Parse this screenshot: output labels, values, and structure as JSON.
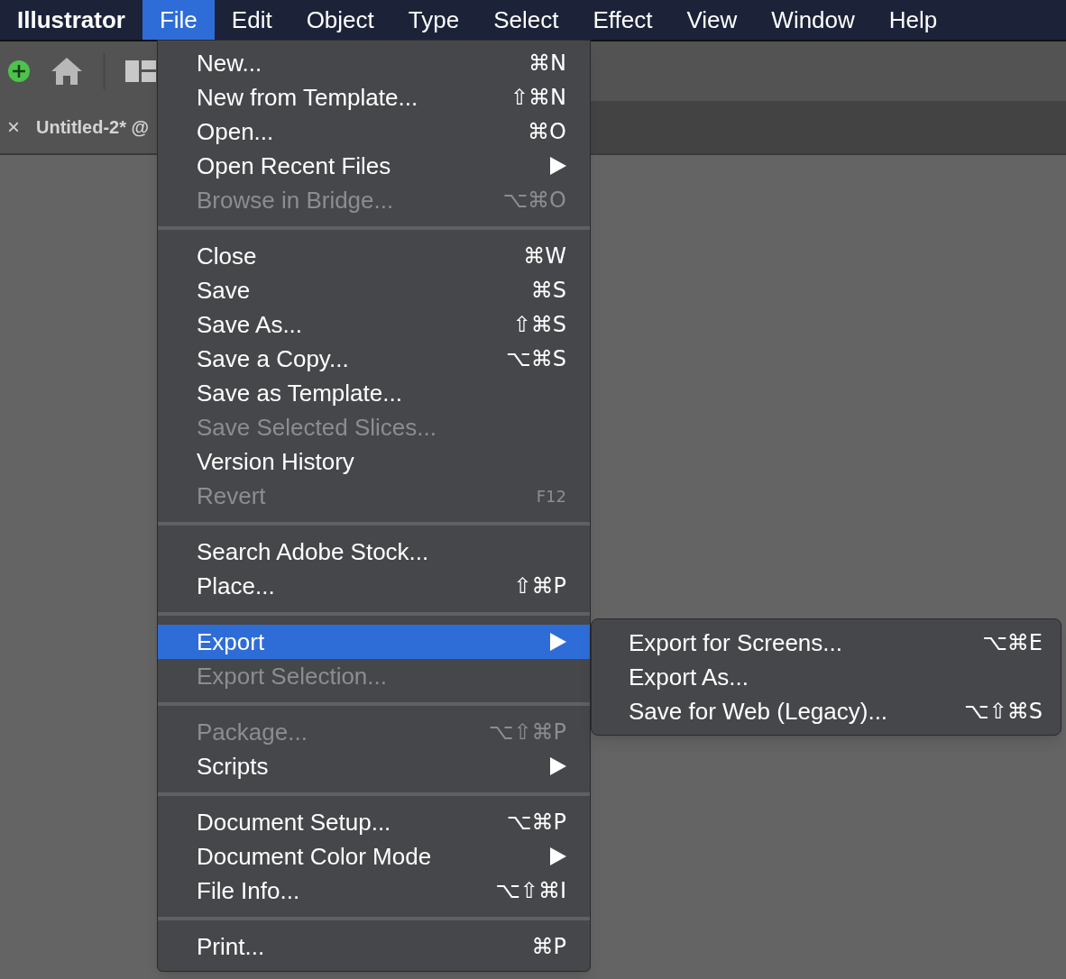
{
  "menubar": {
    "app_name": "Illustrator",
    "menus": [
      {
        "label": "File",
        "selected": true
      },
      {
        "label": "Edit",
        "selected": false
      },
      {
        "label": "Object",
        "selected": false
      },
      {
        "label": "Type",
        "selected": false
      },
      {
        "label": "Select",
        "selected": false
      },
      {
        "label": "Effect",
        "selected": false
      },
      {
        "label": "View",
        "selected": false
      },
      {
        "label": "Window",
        "selected": false
      },
      {
        "label": "Help",
        "selected": false
      }
    ]
  },
  "document_tab": {
    "close": "×",
    "title": "Untitled-2* @"
  },
  "file_menu": {
    "sections": [
      [
        {
          "label": "New...",
          "shortcut": "⌘N",
          "disabled": false,
          "submenu": false,
          "selected": false
        },
        {
          "label": "New from Template...",
          "shortcut": "⇧⌘N",
          "disabled": false,
          "submenu": false,
          "selected": false
        },
        {
          "label": "Open...",
          "shortcut": "⌘O",
          "disabled": false,
          "submenu": false,
          "selected": false
        },
        {
          "label": "Open Recent Files",
          "disabled": false,
          "submenu": true,
          "selected": false
        },
        {
          "label": "Browse in Bridge...",
          "shortcut": "⌥⌘O",
          "disabled": true,
          "submenu": false,
          "selected": false
        }
      ],
      [
        {
          "label": "Close",
          "shortcut": "⌘W",
          "disabled": false,
          "submenu": false,
          "selected": false
        },
        {
          "label": "Save",
          "shortcut": "⌘S",
          "disabled": false,
          "submenu": false,
          "selected": false
        },
        {
          "label": "Save As...",
          "shortcut": "⇧⌘S",
          "disabled": false,
          "submenu": false,
          "selected": false
        },
        {
          "label": "Save a Copy...",
          "shortcut": "⌥⌘S",
          "disabled": false,
          "submenu": false,
          "selected": false
        },
        {
          "label": "Save as Template...",
          "disabled": false,
          "submenu": false,
          "selected": false
        },
        {
          "label": "Save Selected Slices...",
          "disabled": true,
          "submenu": false,
          "selected": false
        },
        {
          "label": "Version History",
          "disabled": false,
          "submenu": false,
          "selected": false
        },
        {
          "label": "Revert",
          "shortcut": "F12",
          "disabled": true,
          "submenu": false,
          "selected": false
        }
      ],
      [
        {
          "label": "Search Adobe Stock...",
          "disabled": false,
          "submenu": false,
          "selected": false
        },
        {
          "label": "Place...",
          "shortcut": "⇧⌘P",
          "disabled": false,
          "submenu": false,
          "selected": false
        }
      ],
      [
        {
          "label": "Export",
          "disabled": false,
          "submenu": true,
          "selected": true
        },
        {
          "label": "Export Selection...",
          "disabled": true,
          "submenu": false,
          "selected": false
        }
      ],
      [
        {
          "label": "Package...",
          "shortcut": "⌥⇧⌘P",
          "disabled": true,
          "submenu": false,
          "selected": false
        },
        {
          "label": "Scripts",
          "disabled": false,
          "submenu": true,
          "selected": false
        }
      ],
      [
        {
          "label": "Document Setup...",
          "shortcut": "⌥⌘P",
          "disabled": false,
          "submenu": false,
          "selected": false
        },
        {
          "label": "Document Color Mode",
          "disabled": false,
          "submenu": true,
          "selected": false
        },
        {
          "label": "File Info...",
          "shortcut": "⌥⇧⌘I",
          "disabled": false,
          "submenu": false,
          "selected": false
        }
      ],
      [
        {
          "label": "Print...",
          "shortcut": "⌘P",
          "disabled": false,
          "submenu": false,
          "selected": false
        }
      ]
    ]
  },
  "export_submenu": {
    "items": [
      {
        "label": "Export for Screens...",
        "shortcut": "⌥⌘E"
      },
      {
        "label": "Export As..."
      },
      {
        "label": "Save for Web (Legacy)...",
        "shortcut": "⌥⇧⌘S"
      }
    ]
  }
}
